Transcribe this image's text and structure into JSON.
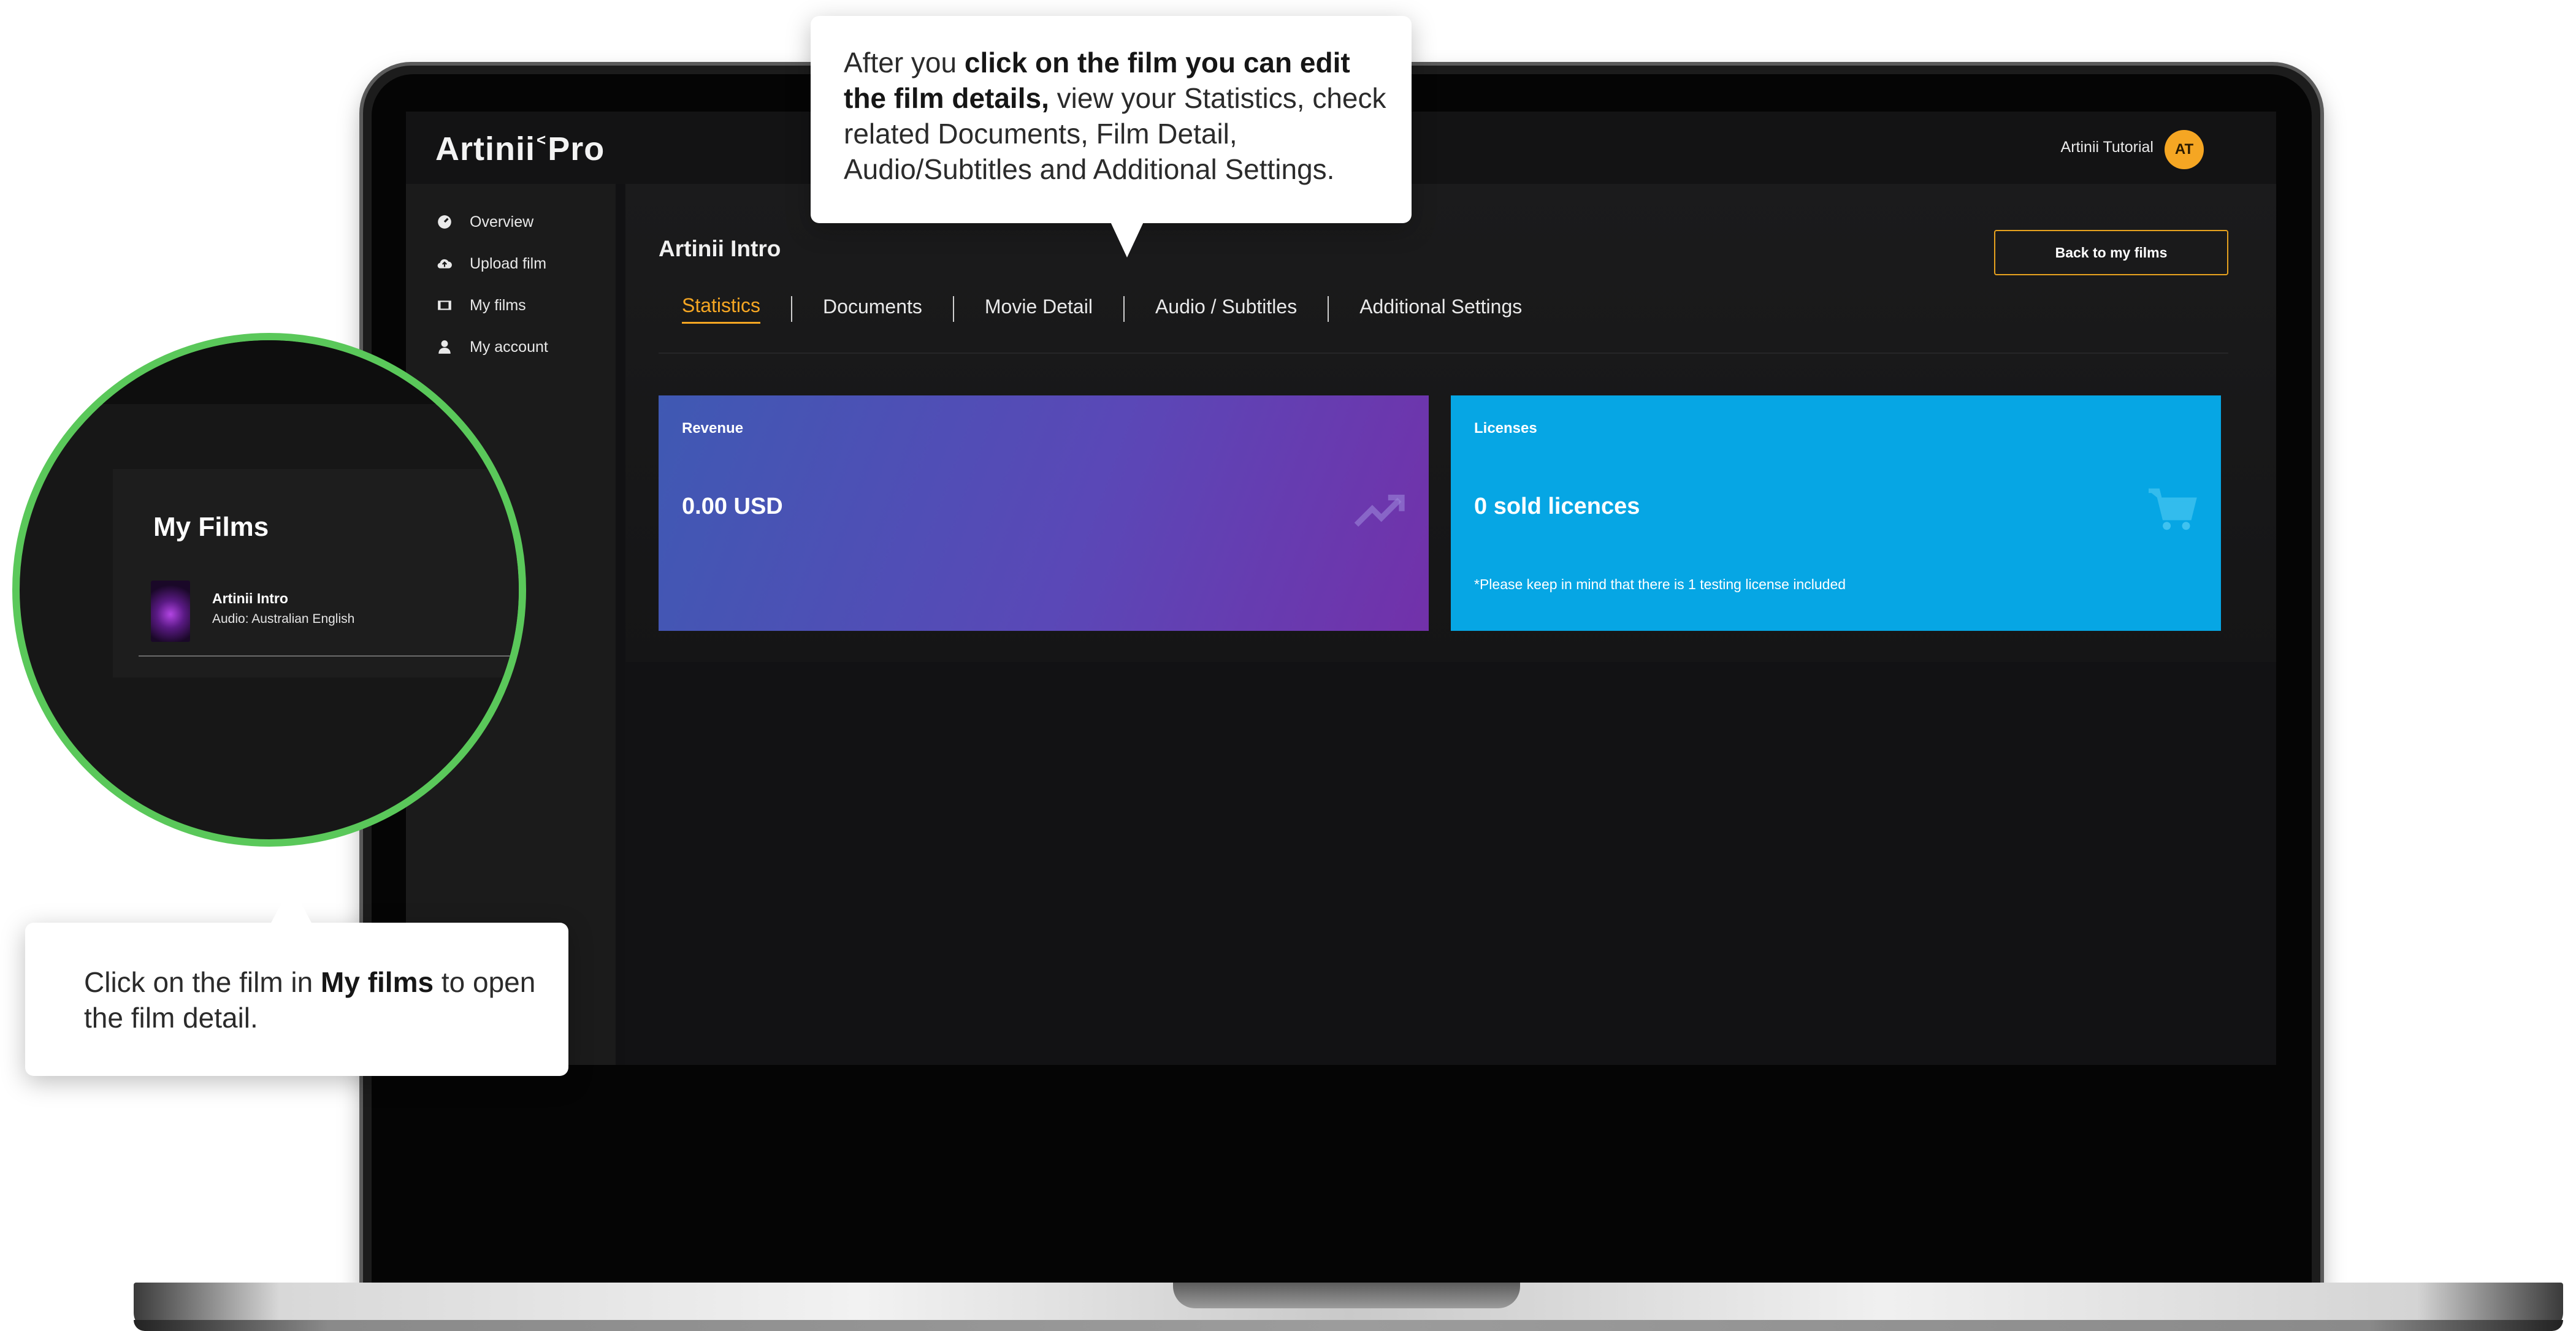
{
  "app": {
    "logo": {
      "left": "Artinii",
      "mark": "<",
      "right": "Pro"
    },
    "user_name": "Artinii Tutorial",
    "user_initials": "AT"
  },
  "sidebar": {
    "items": [
      {
        "label": "Overview",
        "icon": "dashboard-icon"
      },
      {
        "label": "Upload film",
        "icon": "cloud-upload-icon"
      },
      {
        "label": "My films",
        "icon": "film-icon"
      },
      {
        "label": "My account",
        "icon": "user-icon"
      }
    ]
  },
  "main": {
    "film_title": "Artinii Intro",
    "back_button": "Back to my films",
    "tabs": [
      {
        "label": "Statistics",
        "active": true
      },
      {
        "label": "Documents",
        "active": false
      },
      {
        "label": "Movie Detail",
        "active": false
      },
      {
        "label": "Audio / Subtitles",
        "active": false
      },
      {
        "label": "Additional Settings",
        "active": false
      }
    ],
    "cards": {
      "revenue": {
        "label": "Revenue",
        "value": "0.00 USD",
        "icon": "trending-up-icon"
      },
      "licenses": {
        "label": "Licenses",
        "value": "0 sold licences",
        "note": "*Please keep in mind that there is 1 testing license included",
        "icon": "cart-icon"
      }
    }
  },
  "callouts": {
    "top": {
      "prefix": "After you ",
      "bold": "click on the film you can edit the film details,",
      "suffix": " view your Statistics, check related Documents, Film Detail, Audio/Subtitles and Additional Settings."
    },
    "bottom": {
      "prefix": "Click on the film in ",
      "bold": "My films",
      "suffix": " to open the film detail."
    }
  },
  "zoom": {
    "title": "My Films",
    "film_name": "Artinii Intro",
    "film_audio": "Audio: Australian English"
  },
  "colors": {
    "accent": "#f5a623",
    "highlight_ring": "#5ac85a",
    "licenses_card": "#06a6e4"
  }
}
